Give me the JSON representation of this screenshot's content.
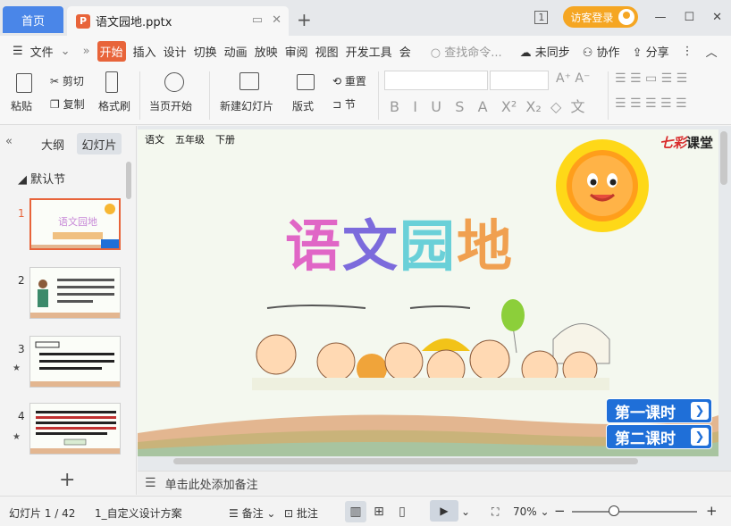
{
  "titlebar": {
    "home_tab": "首页",
    "doc_tab": "语文园地.pptx",
    "doc_icon": "P",
    "page_badge": "1",
    "login": "访客登录"
  },
  "menu": {
    "file": "文件",
    "items": [
      "开始",
      "插入",
      "设计",
      "切换",
      "动画",
      "放映",
      "审阅",
      "视图",
      "开发工具",
      "会"
    ],
    "search_placeholder": "查找命令...",
    "sync": "未同步",
    "collab": "协作",
    "share": "分享"
  },
  "ribbon": {
    "paste": "粘贴",
    "cut": "剪切",
    "copy": "复制",
    "format_painter": "格式刷",
    "start_from_current": "当页开始",
    "new_slide": "新建幻灯片",
    "layout": "版式",
    "reset": "重置",
    "section": "节"
  },
  "left_panel": {
    "outline_tab": "大纲",
    "slides_tab": "幻灯片",
    "section_name": "默认节",
    "slides": [
      {
        "num": "1",
        "has_star": false
      },
      {
        "num": "2",
        "has_star": false
      },
      {
        "num": "3",
        "has_star": true
      },
      {
        "num": "4",
        "has_star": true
      }
    ]
  },
  "slide": {
    "header": [
      "语文",
      "五年级",
      "下册"
    ],
    "brand_prefix": "七彩",
    "brand_suffix": "课堂",
    "title_chars": [
      "语",
      "文",
      "园",
      "地"
    ],
    "lesson1": "第一课时",
    "lesson2": "第二课时"
  },
  "notes": {
    "placeholder": "单击此处添加备注"
  },
  "statusbar": {
    "slide_counter": "幻灯片 1 / 42",
    "theme": "1_自定义设计方案",
    "notes": "备注",
    "comments": "批注",
    "zoom": "70%"
  },
  "colors": {
    "accent_blue": "#4a86e8",
    "accent_orange": "#e8643a",
    "lesson_blue": "#1f6fd8"
  }
}
